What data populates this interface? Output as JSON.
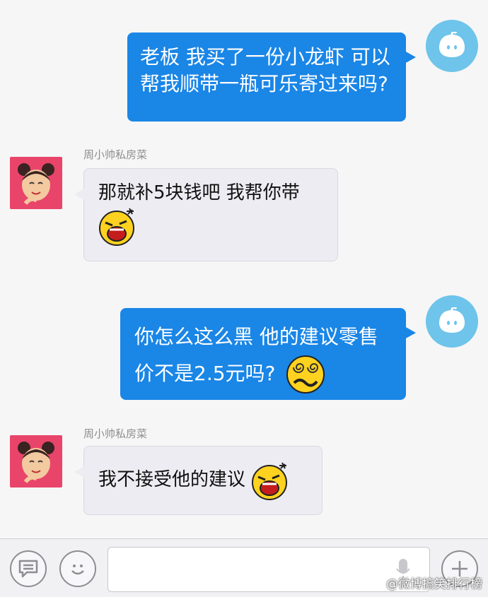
{
  "messages": [
    {
      "sender": "me",
      "text": "老板 我买了一份小龙虾 可以帮我顺带一瓶可乐寄过来吗?"
    },
    {
      "sender": "other",
      "name": "周小帅私房菜",
      "text": "那就补5块钱吧 我帮你带",
      "emoji": "laughing-face-emoji"
    },
    {
      "sender": "me",
      "text": "你怎么这么黑 他的建议零售价不是2.5元吗?",
      "emoji": "dizzy-face-emoji"
    },
    {
      "sender": "other",
      "name": "周小帅私房菜",
      "text": "我不接受他的建议",
      "emoji": "laughing-face-emoji"
    }
  ],
  "input_bar": {
    "input_value": "",
    "left_icons": [
      "chat-bubble-icon",
      "smiley-icon"
    ],
    "right_icons": [
      "microphone-icon",
      "plus-icon"
    ]
  },
  "watermark": "@微博搞笑排行榜",
  "colors": {
    "outgoing_bubble": "#1a86e6",
    "incoming_bubble": "#ececf2",
    "avatar_me": "#6ec4ea",
    "avatar_other": "#e9446a"
  }
}
